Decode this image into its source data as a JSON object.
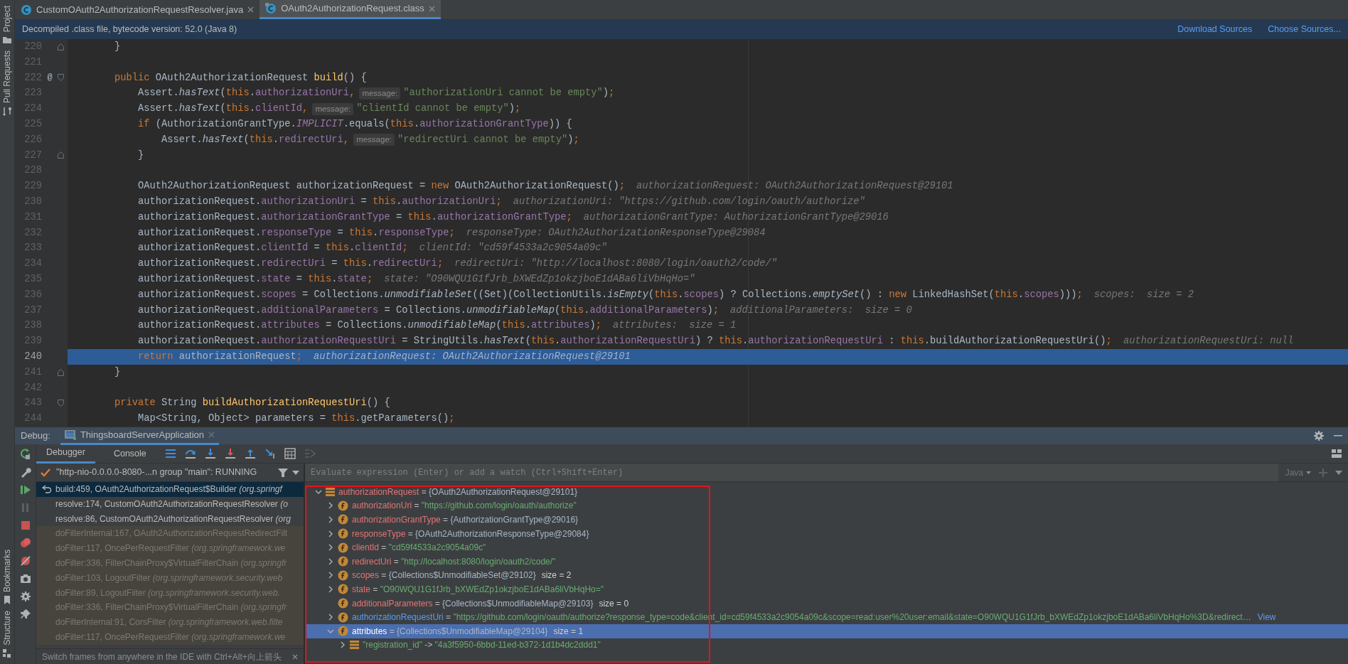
{
  "tool_stripe": {
    "top": [
      {
        "label": "Project"
      },
      {
        "label": "Pull Requests"
      }
    ],
    "bottom": [
      {
        "label": "Bookmarks"
      },
      {
        "label": "Structure"
      }
    ]
  },
  "editor": {
    "tabs": [
      {
        "label": "CustomOAuth2AuthorizationRequestResolver.java",
        "kind": "java",
        "selected": false
      },
      {
        "label": "OAuth2AuthorizationRequest.class",
        "kind": "class",
        "selected": true
      }
    ],
    "banner": {
      "text": "Decompiled .class file, bytecode version: 52.0 (Java 8)",
      "links": [
        "Download Sources",
        "Choose Sources..."
      ]
    },
    "lines": [
      {
        "number": "220",
        "fold_start": false,
        "fold_end": true,
        "current": false,
        "segments": [
          {
            "kind": "code",
            "tokens": [
              {
                "kind": "plain",
                "text": "        }"
              }
            ]
          }
        ]
      },
      {
        "number": "221",
        "fold_start": false,
        "fold_end": false,
        "current": false
      },
      {
        "number": "222",
        "marker": "@",
        "fold_start": true,
        "fold_end": false,
        "current": false,
        "segments": [
          {
            "kind": "code",
            "tokens": [
              {
                "kind": "keyword",
                "text": "        public "
              },
              {
                "kind": "plain",
                "text": "OAuth2AuthorizationRequest "
              },
              {
                "kind": "declaration",
                "text": "build"
              },
              {
                "kind": "plain",
                "text": "() {"
              }
            ]
          }
        ]
      },
      {
        "number": "223",
        "fold_start": false,
        "fold_end": false,
        "current": false,
        "segments": [
          {
            "kind": "code",
            "tokens": [
              {
                "kind": "plain",
                "text": "            Assert."
              },
              {
                "kind": "static_call",
                "text": "hasText"
              },
              {
                "kind": "plain",
                "text": "("
              },
              {
                "kind": "keyword",
                "text": "this"
              },
              {
                "kind": "plain",
                "text": "."
              },
              {
                "kind": "field",
                "text": "authorizationUri"
              },
              {
                "kind": "keyword",
                "text": ","
              }
            ]
          },
          {
            "kind": "hint",
            "text": "message:"
          },
          {
            "kind": "code",
            "tokens": [
              {
                "kind": "string",
                "text": "\"authorizationUri cannot be empty\""
              },
              {
                "kind": "plain",
                "text": ")"
              },
              {
                "kind": "keyword",
                "text": ";"
              }
            ]
          }
        ]
      },
      {
        "number": "224",
        "fold_start": false,
        "fold_end": false,
        "current": false,
        "segments": [
          {
            "kind": "code",
            "tokens": [
              {
                "kind": "plain",
                "text": "            Assert."
              },
              {
                "kind": "static_call",
                "text": "hasText"
              },
              {
                "kind": "plain",
                "text": "("
              },
              {
                "kind": "keyword",
                "text": "this"
              },
              {
                "kind": "plain",
                "text": "."
              },
              {
                "kind": "field",
                "text": "clientId"
              },
              {
                "kind": "keyword",
                "text": ","
              }
            ]
          },
          {
            "kind": "hint",
            "text": "message:"
          },
          {
            "kind": "code",
            "tokens": [
              {
                "kind": "string",
                "text": "\"clientId cannot be empty\""
              },
              {
                "kind": "plain",
                "text": ")"
              },
              {
                "kind": "keyword",
                "text": ";"
              }
            ]
          }
        ]
      },
      {
        "number": "225",
        "fold_start": false,
        "fold_end": false,
        "current": false,
        "segments": [
          {
            "kind": "code",
            "tokens": [
              {
                "kind": "keyword",
                "text": "            if "
              },
              {
                "kind": "plain",
                "text": "(AuthorizationGrantType."
              },
              {
                "kind": "constant",
                "text": "IMPLICIT"
              },
              {
                "kind": "plain",
                "text": ".equals("
              },
              {
                "kind": "keyword",
                "text": "this"
              },
              {
                "kind": "plain",
                "text": "."
              },
              {
                "kind": "field",
                "text": "authorizationGrantType"
              },
              {
                "kind": "plain",
                "text": ")) {"
              }
            ]
          }
        ]
      },
      {
        "number": "226",
        "fold_start": false,
        "fold_end": false,
        "current": false,
        "segments": [
          {
            "kind": "code",
            "tokens": [
              {
                "kind": "plain",
                "text": "                Assert."
              },
              {
                "kind": "static_call",
                "text": "hasText"
              },
              {
                "kind": "plain",
                "text": "("
              },
              {
                "kind": "keyword",
                "text": "this"
              },
              {
                "kind": "plain",
                "text": "."
              },
              {
                "kind": "field",
                "text": "redirectUri"
              },
              {
                "kind": "keyword",
                "text": ","
              }
            ]
          },
          {
            "kind": "hint",
            "text": "message:"
          },
          {
            "kind": "code",
            "tokens": [
              {
                "kind": "string",
                "text": "\"redirectUri cannot be empty\""
              },
              {
                "kind": "plain",
                "text": ")"
              },
              {
                "kind": "keyword",
                "text": ";"
              }
            ]
          }
        ]
      },
      {
        "number": "227",
        "fold_start": false,
        "fold_end": true,
        "current": false,
        "segments": [
          {
            "kind": "code",
            "tokens": [
              {
                "kind": "plain",
                "text": "            }"
              }
            ]
          }
        ]
      },
      {
        "number": "228",
        "fold_start": false,
        "fold_end": false,
        "current": false
      },
      {
        "number": "229",
        "fold_start": false,
        "fold_end": false,
        "current": false,
        "segments": [
          {
            "kind": "code",
            "tokens": [
              {
                "kind": "plain",
                "text": "            OAuth2AuthorizationRequest authorizationRequest = "
              },
              {
                "kind": "keyword",
                "text": "new "
              },
              {
                "kind": "plain",
                "text": "OAuth2AuthorizationRequest()"
              },
              {
                "kind": "keyword",
                "text": ";"
              }
            ]
          },
          {
            "kind": "value",
            "text": "authorizationRequest: OAuth2AuthorizationRequest@29101"
          }
        ]
      },
      {
        "number": "230",
        "fold_start": false,
        "fold_end": false,
        "current": false,
        "segments": [
          {
            "kind": "code",
            "tokens": [
              {
                "kind": "plain",
                "text": "            authorizationRequest."
              },
              {
                "kind": "field",
                "text": "authorizationUri"
              },
              {
                "kind": "plain",
                "text": " = "
              },
              {
                "kind": "keyword",
                "text": "this"
              },
              {
                "kind": "plain",
                "text": "."
              },
              {
                "kind": "field",
                "text": "authorizationUri"
              },
              {
                "kind": "keyword",
                "text": ";"
              }
            ]
          },
          {
            "kind": "value",
            "text": "authorizationUri: \"https://github.com/login/oauth/authorize\""
          }
        ]
      },
      {
        "number": "231",
        "fold_start": false,
        "fold_end": false,
        "current": false,
        "segments": [
          {
            "kind": "code",
            "tokens": [
              {
                "kind": "plain",
                "text": "            authorizationRequest."
              },
              {
                "kind": "field",
                "text": "authorizationGrantType"
              },
              {
                "kind": "plain",
                "text": " = "
              },
              {
                "kind": "keyword",
                "text": "this"
              },
              {
                "kind": "plain",
                "text": "."
              },
              {
                "kind": "field",
                "text": "authorizationGrantType"
              },
              {
                "kind": "keyword",
                "text": ";"
              }
            ]
          },
          {
            "kind": "value",
            "text": "authorizationGrantType: AuthorizationGrantType@29016"
          }
        ]
      },
      {
        "number": "232",
        "fold_start": false,
        "fold_end": false,
        "current": false,
        "segments": [
          {
            "kind": "code",
            "tokens": [
              {
                "kind": "plain",
                "text": "            authorizationRequest."
              },
              {
                "kind": "field",
                "text": "responseType"
              },
              {
                "kind": "plain",
                "text": " = "
              },
              {
                "kind": "keyword",
                "text": "this"
              },
              {
                "kind": "plain",
                "text": "."
              },
              {
                "kind": "field",
                "text": "responseType"
              },
              {
                "kind": "keyword",
                "text": ";"
              }
            ]
          },
          {
            "kind": "value",
            "text": "responseType: OAuth2AuthorizationResponseType@29084"
          }
        ]
      },
      {
        "number": "233",
        "fold_start": false,
        "fold_end": false,
        "current": false,
        "segments": [
          {
            "kind": "code",
            "tokens": [
              {
                "kind": "plain",
                "text": "            authorizationRequest."
              },
              {
                "kind": "field",
                "text": "clientId"
              },
              {
                "kind": "plain",
                "text": " = "
              },
              {
                "kind": "keyword",
                "text": "this"
              },
              {
                "kind": "plain",
                "text": "."
              },
              {
                "kind": "field",
                "text": "clientId"
              },
              {
                "kind": "keyword",
                "text": ";"
              }
            ]
          },
          {
            "kind": "value",
            "text": "clientId: \"cd59f4533a2c9054a09c\""
          }
        ]
      },
      {
        "number": "234",
        "fold_start": false,
        "fold_end": false,
        "current": false,
        "segments": [
          {
            "kind": "code",
            "tokens": [
              {
                "kind": "plain",
                "text": "            authorizationRequest."
              },
              {
                "kind": "field",
                "text": "redirectUri"
              },
              {
                "kind": "plain",
                "text": " = "
              },
              {
                "kind": "keyword",
                "text": "this"
              },
              {
                "kind": "plain",
                "text": "."
              },
              {
                "kind": "field",
                "text": "redirectUri"
              },
              {
                "kind": "keyword",
                "text": ";"
              }
            ]
          },
          {
            "kind": "value",
            "text": "redirectUri: \"http://localhost:8080/login/oauth2/code/\""
          }
        ]
      },
      {
        "number": "235",
        "fold_start": false,
        "fold_end": false,
        "current": false,
        "segments": [
          {
            "kind": "code",
            "tokens": [
              {
                "kind": "plain",
                "text": "            authorizationRequest."
              },
              {
                "kind": "field",
                "text": "state"
              },
              {
                "kind": "plain",
                "text": " = "
              },
              {
                "kind": "keyword",
                "text": "this"
              },
              {
                "kind": "plain",
                "text": "."
              },
              {
                "kind": "field",
                "text": "state"
              },
              {
                "kind": "keyword",
                "text": ";"
              }
            ]
          },
          {
            "kind": "value",
            "text": "state: \"O90WQU1G1fJrb_bXWEdZp1okzjboE1dABa6liVbHqHo=\""
          }
        ]
      },
      {
        "number": "236",
        "fold_start": false,
        "fold_end": false,
        "current": false,
        "segments": [
          {
            "kind": "code",
            "tokens": [
              {
                "kind": "plain",
                "text": "            authorizationRequest."
              },
              {
                "kind": "field",
                "text": "scopes"
              },
              {
                "kind": "plain",
                "text": " = Collections."
              },
              {
                "kind": "static_call",
                "text": "unmodifiableSet"
              },
              {
                "kind": "plain",
                "text": "((Set)(CollectionUtils."
              },
              {
                "kind": "static_call",
                "text": "isEmpty"
              },
              {
                "kind": "plain",
                "text": "("
              },
              {
                "kind": "keyword",
                "text": "this"
              },
              {
                "kind": "plain",
                "text": "."
              },
              {
                "kind": "field",
                "text": "scopes"
              },
              {
                "kind": "plain",
                "text": ") ? Collections."
              },
              {
                "kind": "static_call",
                "text": "emptySet"
              },
              {
                "kind": "plain",
                "text": "() : "
              },
              {
                "kind": "keyword",
                "text": "new "
              },
              {
                "kind": "plain",
                "text": "LinkedHashSet("
              },
              {
                "kind": "keyword",
                "text": "this"
              },
              {
                "kind": "plain",
                "text": "."
              },
              {
                "kind": "field",
                "text": "scopes"
              },
              {
                "kind": "plain",
                "text": ")))"
              },
              {
                "kind": "keyword",
                "text": ";"
              }
            ]
          },
          {
            "kind": "value",
            "text": "scopes:  size = 2"
          }
        ]
      },
      {
        "number": "237",
        "fold_start": false,
        "fold_end": false,
        "current": false,
        "segments": [
          {
            "kind": "code",
            "tokens": [
              {
                "kind": "plain",
                "text": "            authorizationRequest."
              },
              {
                "kind": "field",
                "text": "additionalParameters"
              },
              {
                "kind": "plain",
                "text": " = Collections."
              },
              {
                "kind": "static_call",
                "text": "unmodifiableMap"
              },
              {
                "kind": "plain",
                "text": "("
              },
              {
                "kind": "keyword",
                "text": "this"
              },
              {
                "kind": "plain",
                "text": "."
              },
              {
                "kind": "field",
                "text": "additionalParameters"
              },
              {
                "kind": "plain",
                "text": ")"
              },
              {
                "kind": "keyword",
                "text": ";"
              }
            ]
          },
          {
            "kind": "value",
            "text": "additionalParameters:  size = 0"
          }
        ]
      },
      {
        "number": "238",
        "fold_start": false,
        "fold_end": false,
        "current": false,
        "segments": [
          {
            "kind": "code",
            "tokens": [
              {
                "kind": "plain",
                "text": "            authorizationRequest."
              },
              {
                "kind": "field",
                "text": "attributes"
              },
              {
                "kind": "plain",
                "text": " = Collections."
              },
              {
                "kind": "static_call",
                "text": "unmodifiableMap"
              },
              {
                "kind": "plain",
                "text": "("
              },
              {
                "kind": "keyword",
                "text": "this"
              },
              {
                "kind": "plain",
                "text": "."
              },
              {
                "kind": "field",
                "text": "attributes"
              },
              {
                "kind": "plain",
                "text": ")"
              },
              {
                "kind": "keyword",
                "text": ";"
              }
            ]
          },
          {
            "kind": "value",
            "text": "attributes:  size = 1"
          }
        ]
      },
      {
        "number": "239",
        "fold_start": false,
        "fold_end": false,
        "current": false,
        "segments": [
          {
            "kind": "code",
            "tokens": [
              {
                "kind": "plain",
                "text": "            authorizationRequest."
              },
              {
                "kind": "field",
                "text": "authorizationRequestUri"
              },
              {
                "kind": "plain",
                "text": " = StringUtils."
              },
              {
                "kind": "static_call",
                "text": "hasText"
              },
              {
                "kind": "plain",
                "text": "("
              },
              {
                "kind": "keyword",
                "text": "this"
              },
              {
                "kind": "plain",
                "text": "."
              },
              {
                "kind": "field",
                "text": "authorizationRequestUri"
              },
              {
                "kind": "plain",
                "text": ") ? "
              },
              {
                "kind": "keyword",
                "text": "this"
              },
              {
                "kind": "plain",
                "text": "."
              },
              {
                "kind": "field",
                "text": "authorizationRequestUri"
              },
              {
                "kind": "plain",
                "text": " : "
              },
              {
                "kind": "keyword",
                "text": "this"
              },
              {
                "kind": "plain",
                "text": ".buildAuthorizationRequestUri()"
              },
              {
                "kind": "keyword",
                "text": ";"
              }
            ]
          },
          {
            "kind": "value",
            "text": "authorizationRequestUri: null"
          }
        ]
      },
      {
        "number": "240",
        "fold_start": false,
        "fold_end": false,
        "current": true,
        "segments": [
          {
            "kind": "code",
            "tokens": [
              {
                "kind": "keyword",
                "text": "            return "
              },
              {
                "kind": "plain",
                "text": "authorizationRequest"
              },
              {
                "kind": "keyword",
                "text": ";"
              }
            ]
          },
          {
            "kind": "value",
            "text": "authorizationRequest: OAuth2AuthorizationRequest@29101"
          }
        ]
      },
      {
        "number": "241",
        "fold_start": false,
        "fold_end": true,
        "current": false,
        "segments": [
          {
            "kind": "code",
            "tokens": [
              {
                "kind": "plain",
                "text": "        }"
              }
            ]
          }
        ]
      },
      {
        "number": "242",
        "fold_start": false,
        "fold_end": false,
        "current": false
      },
      {
        "number": "243",
        "fold_start": true,
        "fold_end": false,
        "current": false,
        "segments": [
          {
            "kind": "code",
            "tokens": [
              {
                "kind": "keyword",
                "text": "        private "
              },
              {
                "kind": "plain",
                "text": "String "
              },
              {
                "kind": "declaration",
                "text": "buildAuthorizationRequestUri"
              },
              {
                "kind": "plain",
                "text": "() {"
              }
            ]
          }
        ]
      },
      {
        "number": "244",
        "fold_start": false,
        "fold_end": false,
        "current": false,
        "segments": [
          {
            "kind": "code",
            "tokens": [
              {
                "kind": "plain",
                "text": "            Map<String, Object> parameters = "
              },
              {
                "kind": "keyword",
                "text": "this"
              },
              {
                "kind": "plain",
                "text": ".getParameters()"
              },
              {
                "kind": "keyword",
                "text": ";"
              }
            ]
          }
        ]
      }
    ]
  },
  "debug": {
    "title": "Debug:",
    "session": "ThingsboardServerApplication",
    "tabs": [
      {
        "label": "Debugger",
        "selected": true
      },
      {
        "label": "Console",
        "selected": false
      }
    ],
    "thread": "\"http-nio-0.0.0.0-8080-...n group \"main\": RUNNING",
    "frames": [
      {
        "method": "build:459, OAuth2AuthorizationRequest$Builder",
        "location": "(org.springf",
        "kind": "app",
        "selected": true
      },
      {
        "method": "resolve:174, CustomOAuth2AuthorizationRequestResolver",
        "location": "(o",
        "kind": "app",
        "selected": false
      },
      {
        "method": "resolve:86, CustomOAuth2AuthorizationRequestResolver",
        "location": "(org",
        "kind": "app",
        "selected": false
      },
      {
        "method": "doFilterInternal:167, OAuth2AuthorizationRequestRedirectFilt",
        "kind": "library",
        "selected": false
      },
      {
        "method": "doFilter:117, OncePerRequestFilter",
        "location": "(org.springframework.we",
        "kind": "library",
        "selected": false
      },
      {
        "method": "doFilter:336, FilterChainProxy$VirtualFilterChain",
        "location": "(org.springfr",
        "kind": "library",
        "selected": false
      },
      {
        "method": "doFilter:103, LogoutFilter",
        "location": "(org.springframework.security.web",
        "kind": "library",
        "selected": false
      },
      {
        "method": "doFilter:89, LogoutFilter",
        "location": "(org.springframework.security.web.",
        "kind": "library",
        "selected": false
      },
      {
        "method": "doFilter:336, FilterChainProxy$VirtualFilterChain",
        "location": "(org.springfr",
        "kind": "library",
        "selected": false
      },
      {
        "method": "doFilterInternal:91, CorsFilter",
        "location": "(org.springframework.web.filte",
        "kind": "library",
        "selected": false
      },
      {
        "method": "doFilter:117, OncePerRequestFilter",
        "location": "(org.springframework.we",
        "kind": "library",
        "selected": false
      }
    ],
    "frames_hint": "Switch frames from anywhere in the IDE with Ctrl+Alt+向上箭头",
    "variables": {
      "watch_placeholder": "Evaluate expression (Enter) or add a watch (Ctrl+Shift+Enter)",
      "language": "Java",
      "annotation_frame": true,
      "items": [
        {
          "kind": "object",
          "name": "authorizationRequest",
          "operator": " = ",
          "value": {
            "kind": "object",
            "text": "{OAuth2AuthorizationRequest@29101}"
          },
          "expandable": true,
          "expanded": true,
          "selected": false,
          "changed": false,
          "children": [
            {
              "kind": "field",
              "name": "authorizationUri",
              "operator": " = ",
              "value": {
                "kind": "string",
                "text": "\"https://github.com/login/oauth/authorize\""
              },
              "expandable": true,
              "expanded": false,
              "selected": false,
              "changed": false
            },
            {
              "kind": "field",
              "name": "authorizationGrantType",
              "operator": " = ",
              "value": {
                "kind": "object",
                "text": "{AuthorizationGrantType@29016}"
              },
              "expandable": true,
              "expanded": false,
              "selected": false,
              "changed": false
            },
            {
              "kind": "field",
              "name": "responseType",
              "operator": " = ",
              "value": {
                "kind": "object",
                "text": "{OAuth2AuthorizationResponseType@29084}"
              },
              "expandable": true,
              "expanded": false,
              "selected": false,
              "changed": false
            },
            {
              "kind": "field",
              "name": "clientId",
              "operator": " = ",
              "value": {
                "kind": "string",
                "text": "\"cd59f4533a2c9054a09c\""
              },
              "expandable": true,
              "expanded": false,
              "selected": false,
              "changed": false
            },
            {
              "kind": "field",
              "name": "redirectUri",
              "operator": " = ",
              "value": {
                "kind": "string",
                "text": "\"http://localhost:8080/login/oauth2/code/\""
              },
              "expandable": true,
              "expanded": false,
              "selected": false,
              "changed": false
            },
            {
              "kind": "field",
              "name": "scopes",
              "operator": " = ",
              "value": {
                "kind": "object",
                "text": "{Collections$UnmodifiableSet@29102}"
              },
              "size": "size = 2",
              "expandable": true,
              "expanded": false,
              "selected": false,
              "changed": false
            },
            {
              "kind": "field",
              "name": "state",
              "operator": " = ",
              "value": {
                "kind": "string",
                "text": "\"O90WQU1G1fJrb_bXWEdZp1okzjboE1dABa6liVbHqHo=\""
              },
              "expandable": true,
              "expanded": false,
              "selected": false,
              "changed": false
            },
            {
              "kind": "field",
              "name": "additionalParameters",
              "operator": " = ",
              "value": {
                "kind": "object",
                "text": "{Collections$UnmodifiableMap@29103}"
              },
              "size": "size = 0",
              "expandable": false,
              "expanded": false,
              "selected": false,
              "changed": false
            },
            {
              "kind": "field",
              "name": "authorizationRequestUri",
              "operator": " = ",
              "value": {
                "kind": "string",
                "text": "\"https://github.com/login/oauth/authorize?response_type=code&client_id=cd59f4533a2c9054a09c&scope=read:user%20user:email&state=O90WQU1G1fJrb_bXWEdZp1okzjboE1dABa6liVbHqHo%3D&redirect…"
              },
              "link": "View",
              "expandable": true,
              "expanded": false,
              "selected": false,
              "changed": true
            },
            {
              "kind": "field",
              "name": "attributes",
              "operator": " = ",
              "value": {
                "kind": "object",
                "text": "{Collections$UnmodifiableMap@29104}"
              },
              "size": "size = 1",
              "expandable": true,
              "expanded": true,
              "selected": true,
              "changed": false,
              "children": [
                {
                  "kind": "entry",
                  "name": "\"registration_id\"",
                  "operator": " -> ",
                  "value": {
                    "kind": "string",
                    "text": "\"4a3f5950-6bbd-11ed-b372-1d1b4dc2ddd1\""
                  },
                  "expandable": true,
                  "expanded": false,
                  "selected": false,
                  "changed": false
                }
              ]
            }
          ]
        }
      ]
    }
  }
}
